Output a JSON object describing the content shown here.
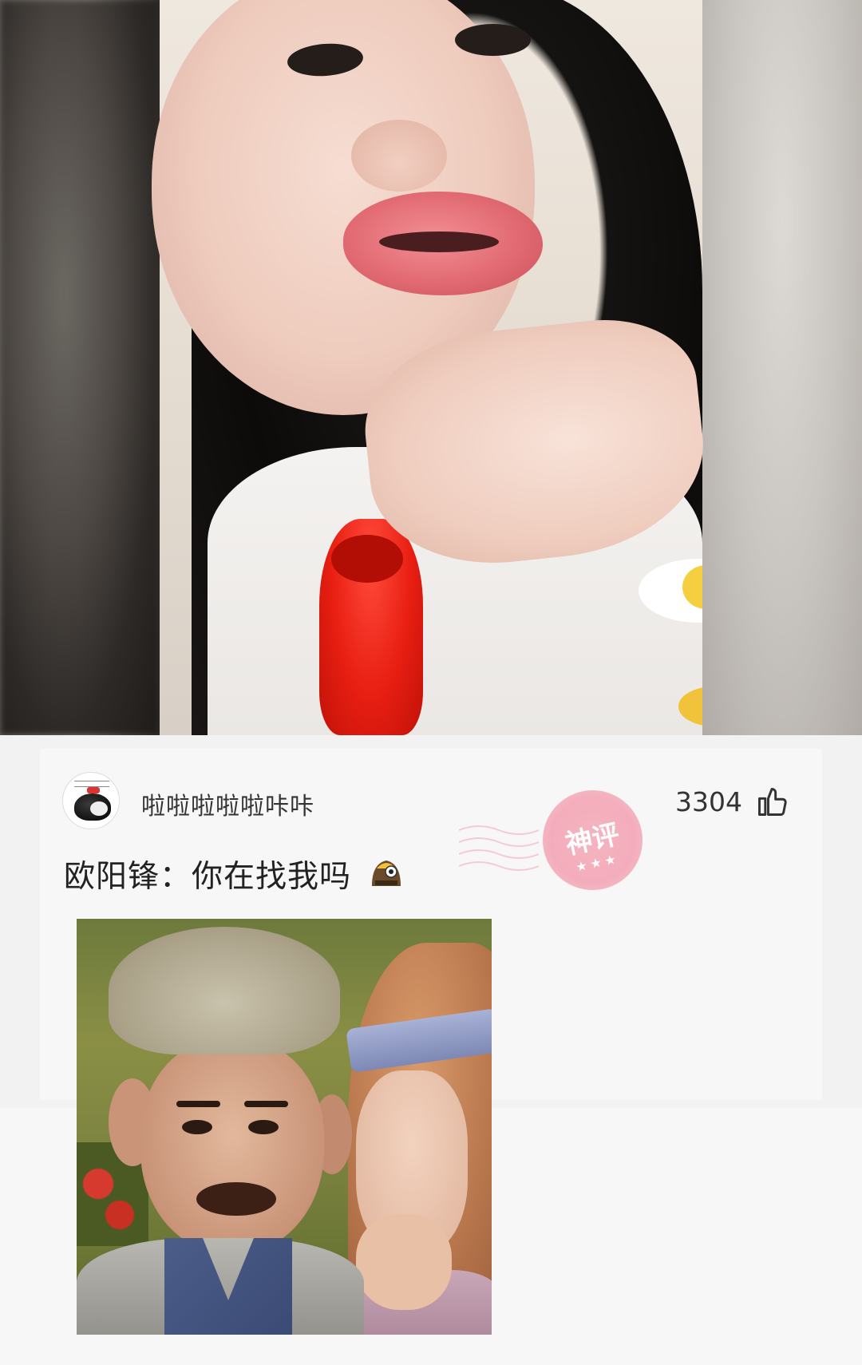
{
  "comment": {
    "username": "啦啦啦啦啦咔咔",
    "like_count": "3304",
    "text": "欧阳锋：你在找我吗",
    "badge": {
      "label": "神评",
      "stars": "★★★",
      "color": "#f3a0b1"
    }
  },
  "icons": {
    "like": "thumbs-up-icon",
    "emoji": "kid-face-emoji-icon",
    "avatar": "cat-avatar"
  }
}
